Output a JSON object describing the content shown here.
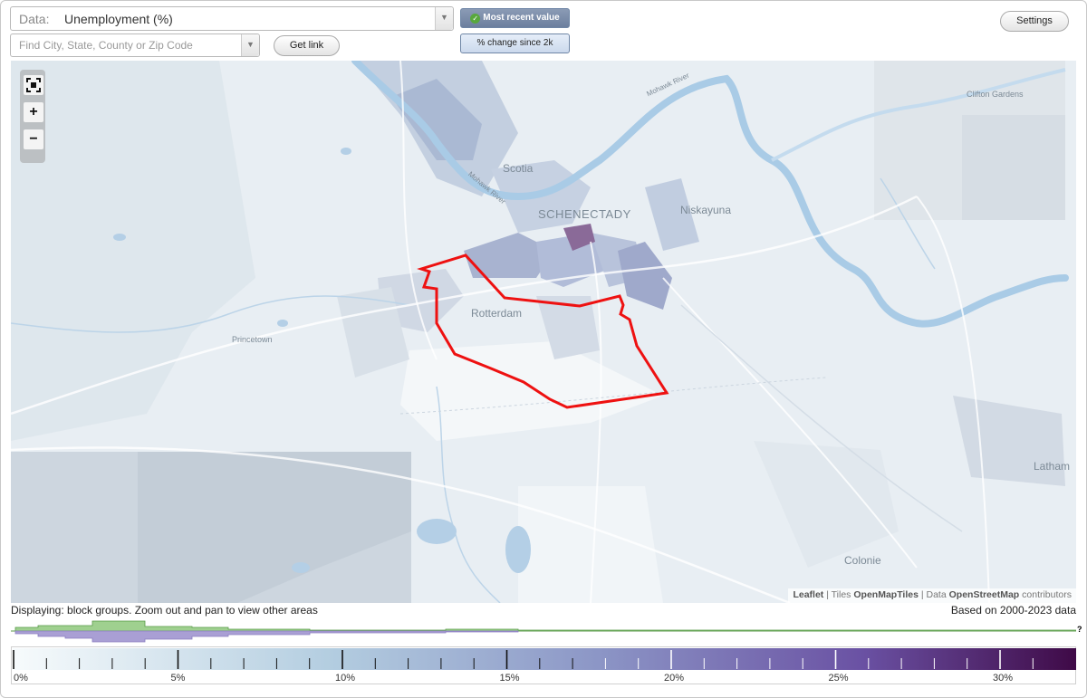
{
  "data_select": {
    "label": "Data:",
    "value": "Unemployment (%)"
  },
  "find": {
    "placeholder": "Find City, State, County or Zip Code"
  },
  "buttons": {
    "get_link": "Get link",
    "settings": "Settings"
  },
  "toggles": {
    "most_recent": "Most recent value",
    "change_since": "% change since 2k"
  },
  "zoom": {
    "fit_icon": "fullscreen-icon",
    "zoom_in": "+",
    "zoom_out": "−"
  },
  "map": {
    "places": {
      "scotia": "Scotia",
      "schenectady": "SCHENECTADY",
      "niskayuna": "Niskayuna",
      "clifton_gardens": "Clifton Gardens",
      "rotterdam": "Rotterdam",
      "princetown": "Princetown",
      "latham": "Latham",
      "colonie": "Colonie",
      "mohawk_river_1": "Mohawk River",
      "mohawk_river_2": "Mohawk River"
    },
    "attribution": {
      "leaflet": "Leaflet",
      "sep1": " | Tiles ",
      "tiles": "OpenMapTiles",
      "sep2": " | Data ",
      "data": "OpenStreetMap",
      "suffix": " contributors"
    },
    "colors": {
      "highlight_outline": "#ee1111",
      "water": "#a9cbe6",
      "base": "#e7edf2"
    }
  },
  "footer": {
    "displaying": "Displaying: block groups. Zoom out and pan to view other areas",
    "based_on": "Based on 2000-2023 data",
    "unknown_marker": "?"
  },
  "legend": {
    "tick_labels": [
      "0%",
      "5%",
      "10%",
      "15%",
      "20%",
      "25%",
      "30%"
    ],
    "gradient_colors": [
      "#f7fbfc",
      "#b3cde0",
      "#8c96c6",
      "#6a51a3",
      "#3f0a47"
    ]
  }
}
